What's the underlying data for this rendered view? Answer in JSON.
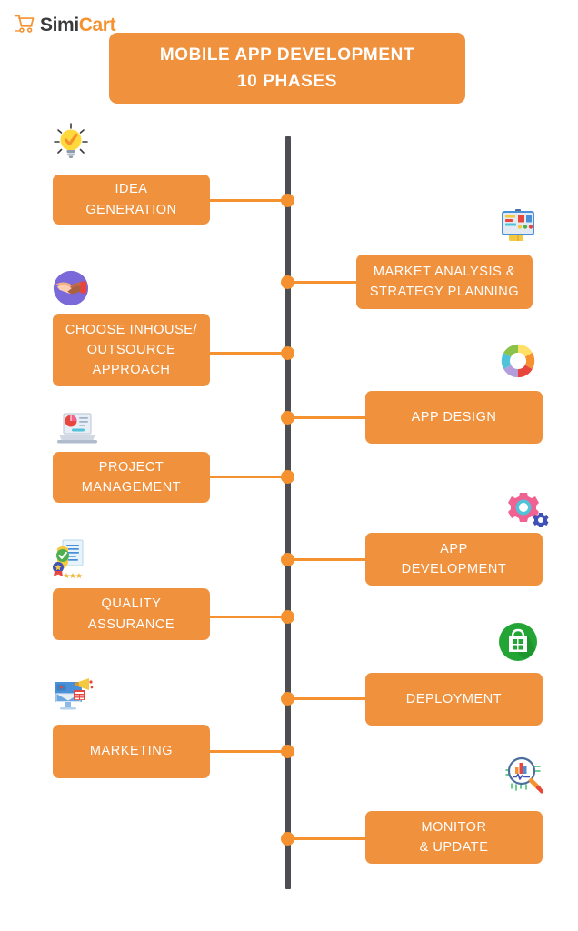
{
  "brand": {
    "name_part1": "Simi",
    "name_part2": "Cart",
    "cart_icon": "shopping-cart-icon",
    "accent_color": "#F5922F",
    "dark_color": "#3a3a3a"
  },
  "header": {
    "title_line1": "MOBILE APP DEVELOPMENT",
    "title_line2": "10 PHASES",
    "background_color": "#F0913E",
    "text_color": "#FFFFFF"
  },
  "timeline": {
    "axis_color": "#4d4d52",
    "node_color": "#F5922F",
    "connector_color": "#F5922F",
    "node_count": 10
  },
  "phases": [
    {
      "index": 1,
      "side": "left",
      "lines": [
        "IDEA",
        "GENERATION"
      ],
      "icon": "lightbulb-check-icon",
      "icon_colors": {
        "primary": "#FFD83B",
        "accent": "#F5922F",
        "base": "#8D9BAD"
      }
    },
    {
      "index": 2,
      "side": "right",
      "lines": [
        "MARKET ANALYSIS &",
        "STRATEGY PLANNING"
      ],
      "icon": "presentation-board-icon",
      "icon_colors": {
        "primary": "#4A90D9",
        "accent": "#E8453C",
        "base": "#F5C842"
      }
    },
    {
      "index": 3,
      "side": "left",
      "lines": [
        "CHOOSE INHOUSE/",
        "OUTSOURCE",
        "APPROACH"
      ],
      "icon": "handshake-icon",
      "icon_colors": {
        "primary": "#7B68D9",
        "accent": "#F4B183",
        "base": "#C1694F"
      }
    },
    {
      "index": 4,
      "side": "right",
      "lines": [
        "APP DESIGN"
      ],
      "icon": "color-wheel-icon",
      "icon_colors": {
        "primary": "#4FC3D9",
        "accent": "#F5922F",
        "base": "#E8453C"
      }
    },
    {
      "index": 5,
      "side": "left",
      "lines": [
        "PROJECT",
        "MANAGEMENT"
      ],
      "icon": "laptop-chart-icon",
      "icon_colors": {
        "primary": "#E8453C",
        "accent": "#4FC3D9",
        "base": "#CFD8E3"
      }
    },
    {
      "index": 6,
      "side": "right",
      "lines": [
        "APP",
        "DEVELOPMENT"
      ],
      "icon": "gears-icon",
      "icon_colors": {
        "primary": "#F06292",
        "accent": "#4FC3D9",
        "base": "#3F51B5"
      }
    },
    {
      "index": 7,
      "side": "left",
      "lines": [
        "QUALITY",
        "ASSURANCE"
      ],
      "icon": "certificate-badge-icon",
      "icon_colors": {
        "primary": "#4CAF50",
        "accent": "#3F51B5",
        "base": "#9DD4F2"
      }
    },
    {
      "index": 8,
      "side": "right",
      "lines": [
        "DEPLOYMENT"
      ],
      "icon": "app-store-bag-icon",
      "icon_colors": {
        "primary": "#22A534",
        "accent": "#FFFFFF",
        "base": "#1B8A2A"
      }
    },
    {
      "index": 9,
      "side": "left",
      "lines": [
        "MARKETING"
      ],
      "icon": "digital-marketing-icon",
      "icon_colors": {
        "primary": "#4A90D9",
        "accent": "#F5C842",
        "base": "#E8453C"
      }
    },
    {
      "index": 10,
      "side": "right",
      "lines": [
        "MONITOR",
        "& UPDATE"
      ],
      "icon": "magnifier-analytics-icon",
      "icon_colors": {
        "primary": "#4FC3D9",
        "accent": "#F5922F",
        "base": "#2E7D32"
      }
    }
  ]
}
